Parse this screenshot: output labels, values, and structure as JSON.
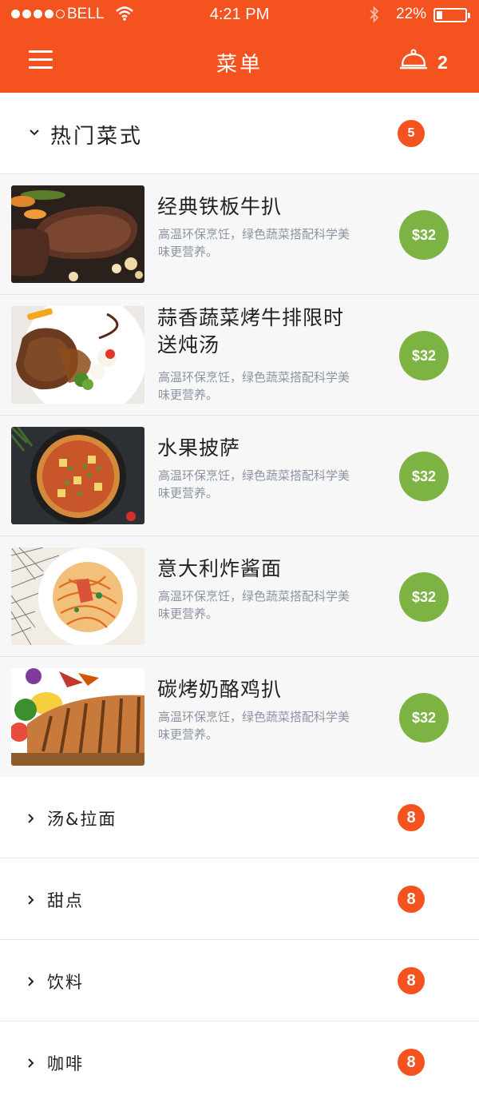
{
  "status_bar": {
    "carrier": "BELL",
    "time": "4:21 PM",
    "battery_percent": "22%",
    "battery_level": 0.22,
    "signal_bars_filled": 4,
    "signal_bars_total": 5
  },
  "nav": {
    "title": "菜单",
    "menu_icon": "hamburger-icon",
    "cart_icon": "cloche-icon",
    "cart_count": "2"
  },
  "colors": {
    "accent": "#f4521f",
    "price_green": "#7cb342",
    "desc_gray": "#8b95a3"
  },
  "hot_category": {
    "label": "热门菜式",
    "count": "5",
    "expanded": true
  },
  "dishes": [
    {
      "name": "经典铁板牛扒",
      "desc": "高温环保烹饪，绿色蔬菜搭配科学美味更营养。",
      "price": "$32"
    },
    {
      "name": "蒜香蔬菜烤牛排限时送炖汤",
      "desc": "高温环保烹饪，绿色蔬菜搭配科学美味更营养。",
      "price": "$32"
    },
    {
      "name": "水果披萨",
      "desc": "高温环保烹饪，绿色蔬菜搭配科学美味更营养。",
      "price": "$32"
    },
    {
      "name": "意大利炸酱面",
      "desc": "高温环保烹饪，绿色蔬菜搭配科学美味更营养。",
      "price": "$32"
    },
    {
      "name": "碳烤奶酪鸡扒",
      "desc": "高温环保烹饪，绿色蔬菜搭配科学美味更营养。",
      "price": "$32"
    }
  ],
  "categories": [
    {
      "label": "汤&拉面",
      "count": "8"
    },
    {
      "label": "甜点",
      "count": "8"
    },
    {
      "label": "饮料",
      "count": "8"
    },
    {
      "label": "咖啡",
      "count": "8"
    }
  ]
}
